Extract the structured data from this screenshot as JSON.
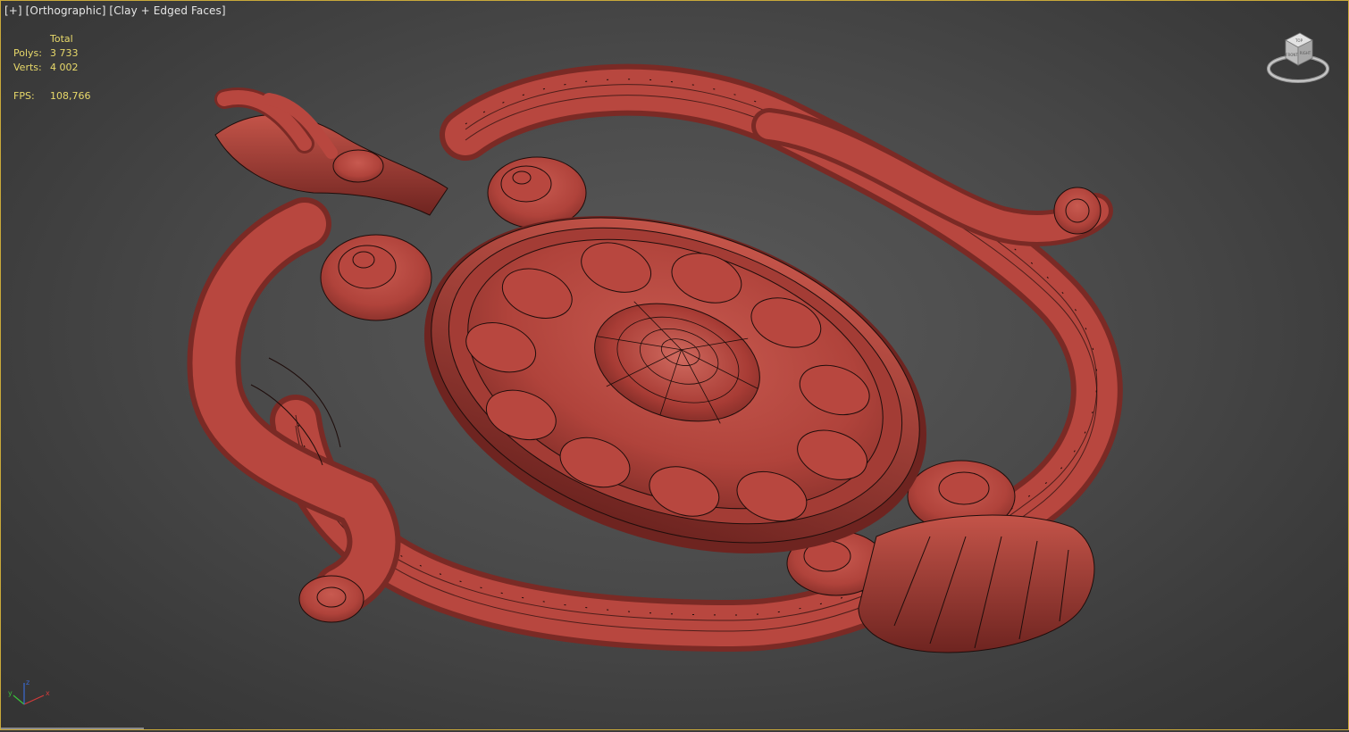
{
  "viewport": {
    "label_plus": "[+]",
    "label_view": "[Orthographic]",
    "label_shading": "[Clay + Edged Faces]",
    "border_color": "#c9a93a",
    "model_color": "#b8473f",
    "wire_color": "#1e0d0b"
  },
  "stats": {
    "header": "Total",
    "polys_label": "Polys:",
    "polys_value": "3 733",
    "verts_label": "Verts:",
    "verts_value": "4 002",
    "fps_label": "FPS:",
    "fps_value": "108,766",
    "text_color": "#e8d96a"
  },
  "viewcube": {
    "face_top": "TOP",
    "face_front": "FRONT",
    "face_right": "RIGHT"
  },
  "gizmo": {
    "x": "x",
    "y": "y",
    "z": "z"
  }
}
